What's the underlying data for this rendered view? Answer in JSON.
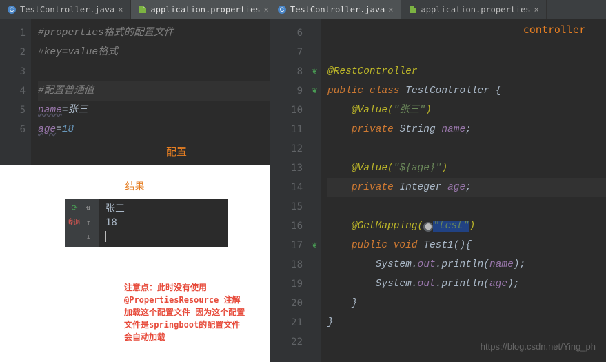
{
  "left": {
    "tabs": [
      {
        "label": "TestController.java",
        "active": false,
        "icon": "class"
      },
      {
        "label": "application.properties",
        "active": true,
        "icon": "props"
      }
    ],
    "lines": [
      "1",
      "2",
      "3",
      "4",
      "5",
      "6"
    ],
    "code": {
      "l1": "#properties格式的配置文件",
      "l2": "#key=value格式",
      "l4": "#配置普通值",
      "l5k": "name",
      "l5e": "=",
      "l5v": "张三",
      "l6k": "age",
      "l6e": "=",
      "l6v": "18"
    },
    "label_config": "配置",
    "label_result": "结果",
    "console": {
      "out1": "张三",
      "out2": "18"
    },
    "note": "注意点：此时没有使用@PropertiesResource 注解加载这个配置文件 因为这个配置文件是springboot的配置文件 会自动加载"
  },
  "right": {
    "tabs": [
      {
        "label": "TestController.java",
        "active": true,
        "icon": "class"
      },
      {
        "label": "application.properties",
        "active": false,
        "icon": "props"
      }
    ],
    "lines": [
      "6",
      "7",
      "8",
      "9",
      "10",
      "11",
      "12",
      "13",
      "14",
      "15",
      "16",
      "17",
      "18",
      "19",
      "20",
      "21",
      "22"
    ],
    "label_controller": "controller",
    "code": {
      "anno_rest": "@RestController",
      "kw_public": "public ",
      "kw_class": "class ",
      "cls_name": "TestController ",
      "brace_o": "{",
      "anno_val1a": "@Value(",
      "str1": "\"张三\"",
      "anno_val1b": ")",
      "kw_priv1": "private ",
      "type_str": "String ",
      "fld_name": "name",
      "semi": ";",
      "anno_val2a": "@Value(",
      "str2": "\"${age}\"",
      "anno_val2b": ")",
      "kw_priv2": "private ",
      "type_int": "Integer ",
      "fld_age": "age",
      "anno_get_a": "@GetMapping(",
      "str3": "\"test\"",
      "anno_get_b": ")",
      "kw_pub2": "public ",
      "kw_void": "void ",
      "meth": "Test1",
      "paren": "()",
      "brace_o2": "{",
      "sys1a": "System.",
      "sys1b": "out",
      "sys1c": ".println(",
      "sys1d": "name",
      "sys1e": ");",
      "sys2a": "System.",
      "sys2b": "out",
      "sys2c": ".println(",
      "sys2d": "age",
      "sys2e": ");",
      "brace_c1": "}",
      "brace_c2": "}"
    },
    "watermark": "https://blog.csdn.net/Ying_ph"
  }
}
